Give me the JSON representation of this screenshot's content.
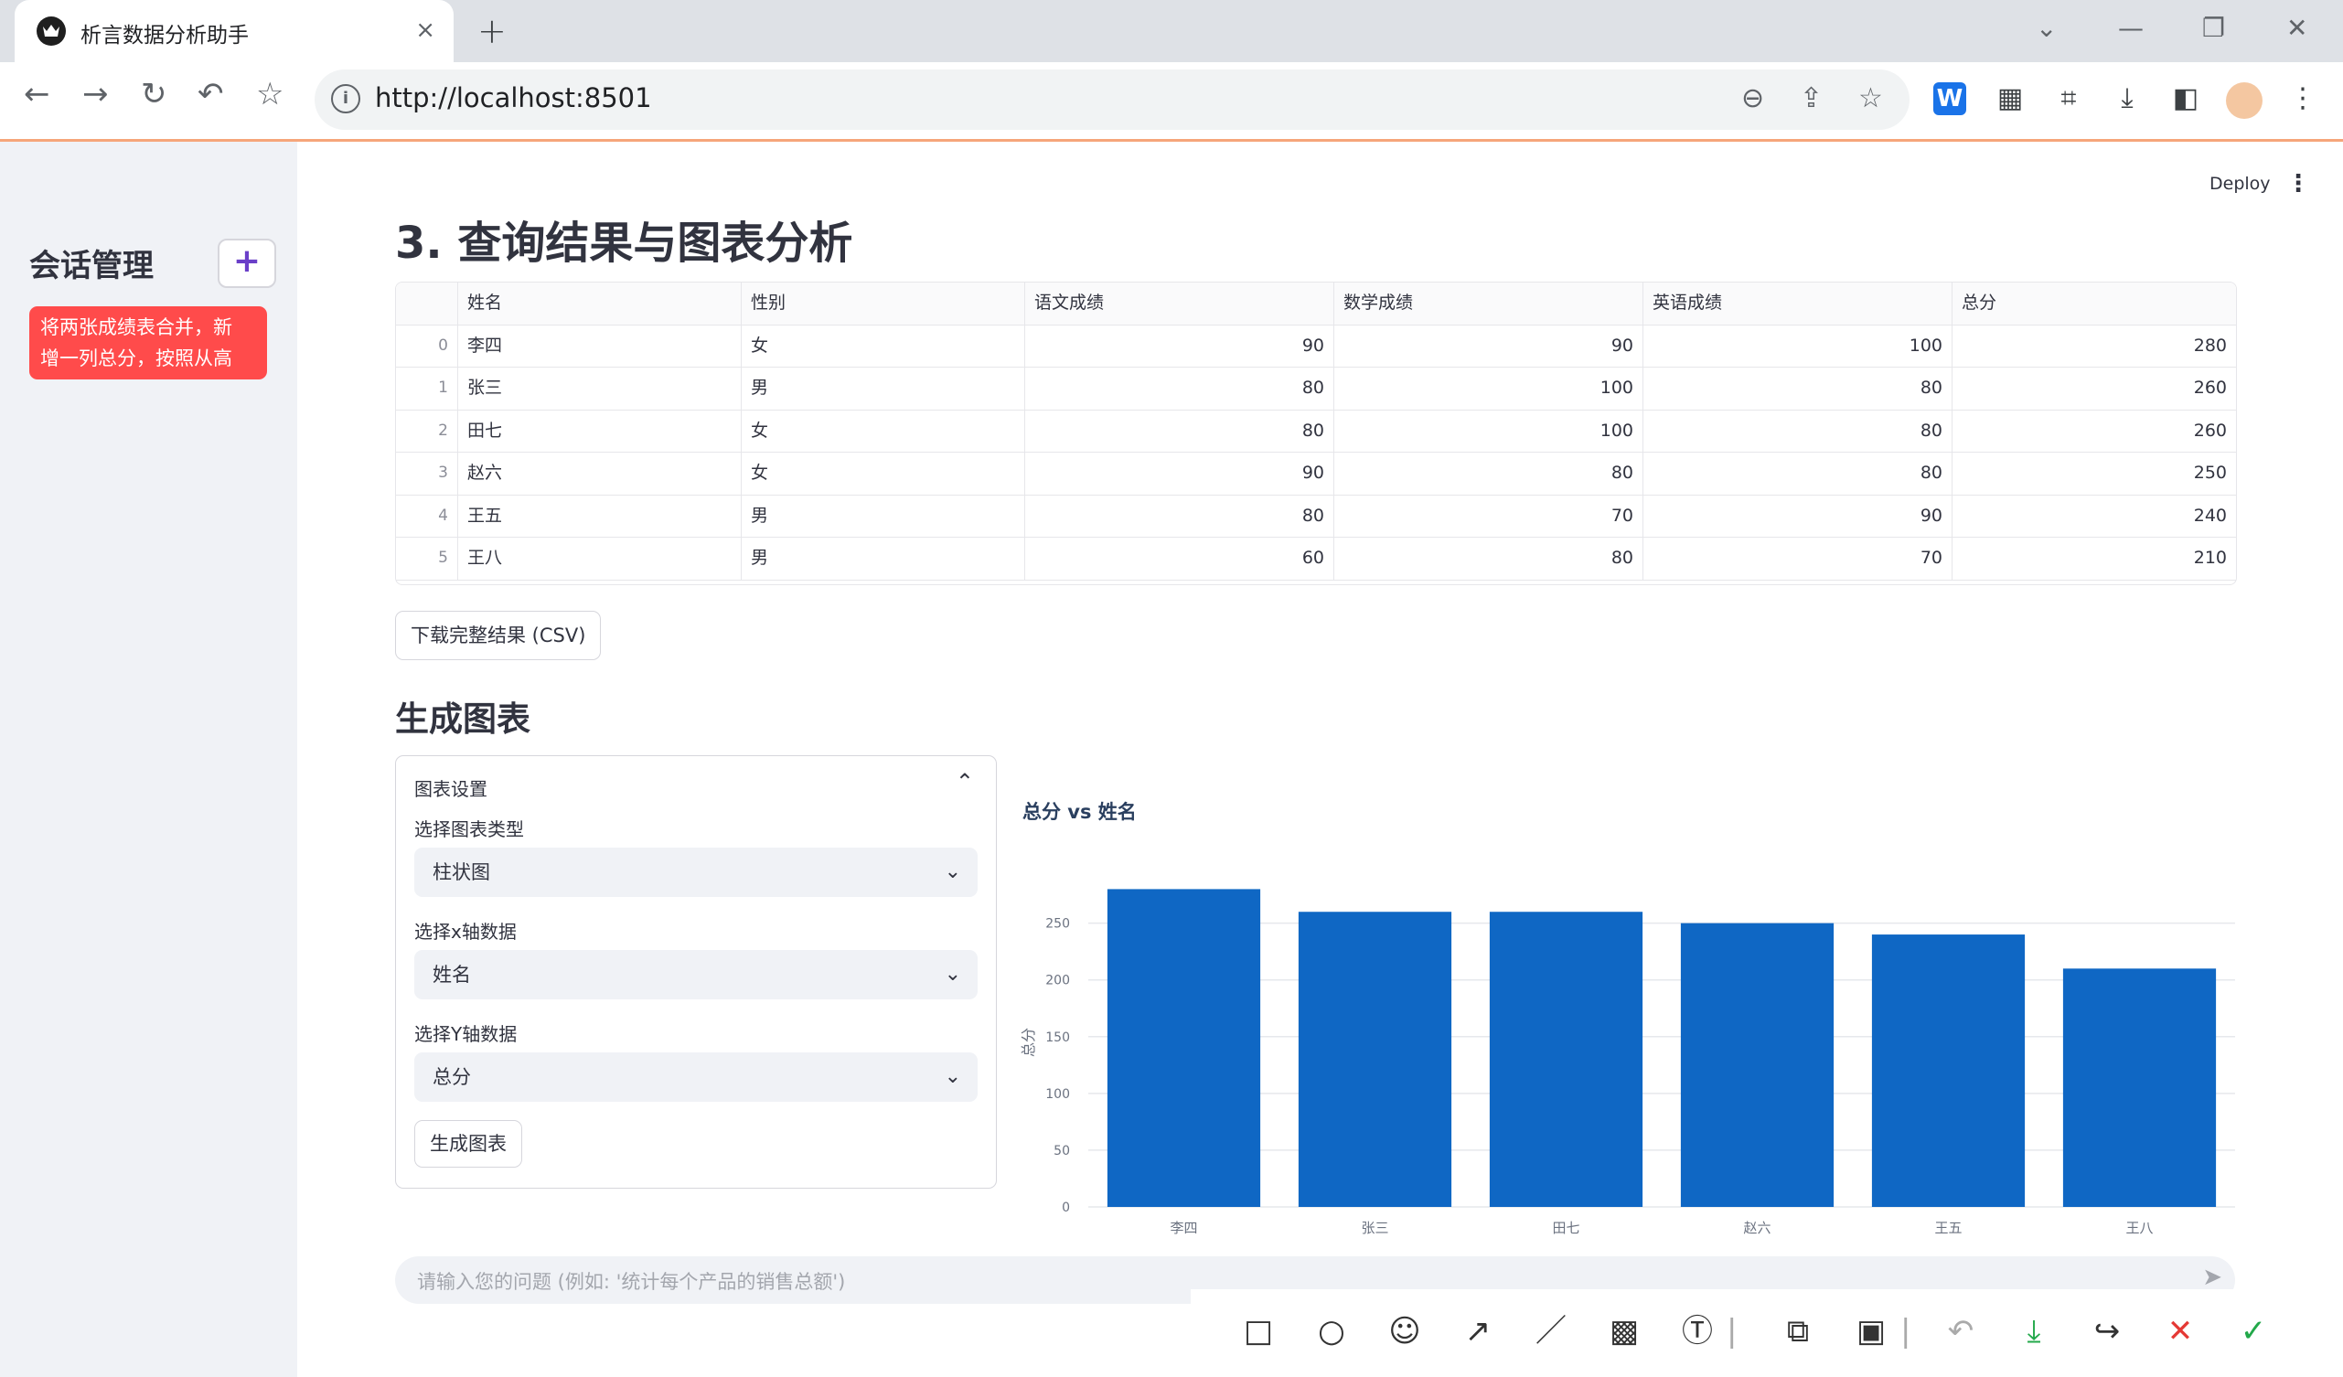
{
  "browser": {
    "tab_title": "析言数据分析助手",
    "url": "http://localhost:8501"
  },
  "sidebar": {
    "title": "会话管理",
    "add_label": "+",
    "session_line1": "将两张成绩表合并，新",
    "session_line2": "增一列总分，按照从高"
  },
  "header": {
    "deploy_label": "Deploy"
  },
  "main": {
    "query_heading": "3. 查询结果与图表分析",
    "table": {
      "columns": [
        "姓名",
        "性别",
        "语文成绩",
        "数学成绩",
        "英语成绩",
        "总分"
      ],
      "rows": [
        {
          "idx": "0",
          "name": "李四",
          "gender": "女",
          "chinese": "90",
          "math": "90",
          "english": "100",
          "total": "280"
        },
        {
          "idx": "1",
          "name": "张三",
          "gender": "男",
          "chinese": "80",
          "math": "100",
          "english": "80",
          "total": "260"
        },
        {
          "idx": "2",
          "name": "田七",
          "gender": "女",
          "chinese": "80",
          "math": "100",
          "english": "80",
          "total": "260"
        },
        {
          "idx": "3",
          "name": "赵六",
          "gender": "女",
          "chinese": "90",
          "math": "80",
          "english": "80",
          "total": "250"
        },
        {
          "idx": "4",
          "name": "王五",
          "gender": "男",
          "chinese": "80",
          "math": "70",
          "english": "90",
          "total": "240"
        },
        {
          "idx": "5",
          "name": "王八",
          "gender": "男",
          "chinese": "60",
          "math": "80",
          "english": "70",
          "total": "210"
        }
      ]
    },
    "download_label": "下载完整结果 (CSV)",
    "chart_heading": "生成图表",
    "settings": {
      "title": "图表设置",
      "type_label": "选择图表类型",
      "type_value": "柱状图",
      "x_label": "选择x轴数据",
      "x_value": "姓名",
      "y_label": "选择Y轴数据",
      "y_value": "总分",
      "generate_label": "生成图表"
    },
    "chat_placeholder": "请输入您的问题 (例如: '统计每个产品的销售总额')"
  },
  "chart_data": {
    "type": "bar",
    "title": "总分 vs 姓名",
    "xlabel": "",
    "ylabel": "总分",
    "categories": [
      "李四",
      "张三",
      "田七",
      "赵六",
      "王五",
      "王八"
    ],
    "values": [
      280,
      260,
      260,
      250,
      240,
      210
    ],
    "ylim": [
      0,
      290
    ],
    "yticks": [
      0,
      50,
      100,
      150,
      200,
      250
    ],
    "bar_color": "#0f67c4",
    "grid": true
  },
  "colors": {
    "accent_red": "#ff4b4b",
    "sidebar_bg": "#f0f2f6"
  }
}
